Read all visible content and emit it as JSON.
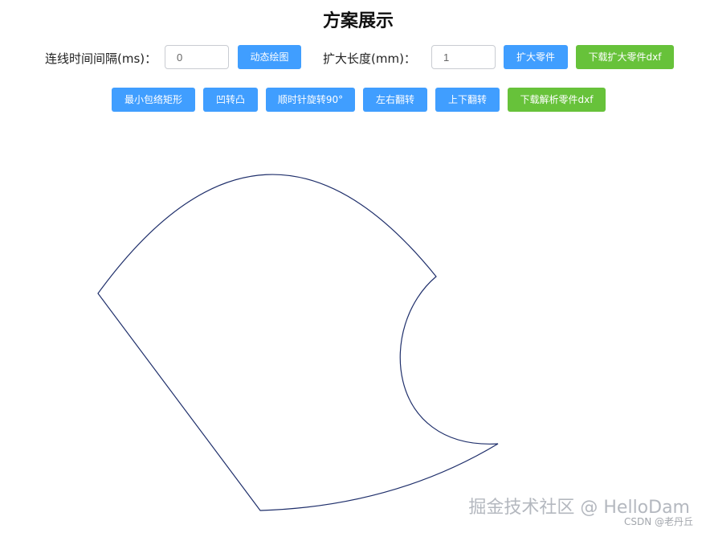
{
  "page": {
    "title": "方案展示"
  },
  "controls": {
    "interval_label": "连线时间间隔(ms)：",
    "interval_value": "0",
    "draw_button": "动态绘图",
    "expand_label": "扩大长度(mm)：",
    "expand_value": "1",
    "expand_button": "扩大零件",
    "download_expanded_button": "下载扩大零件dxf"
  },
  "actions": {
    "min_rect": "最小包络矩形",
    "concave_to_convex": "凹转凸",
    "rotate_cw": "顺时针旋转90°",
    "flip_lr": "左右翻转",
    "flip_ud": "上下翻转",
    "download_parsed": "下载解析零件dxf"
  },
  "colors": {
    "primary": "#409eff",
    "success": "#67c23a",
    "shape_stroke": "#1f2f6b"
  },
  "watermark": {
    "main": "掘金技术社区 @ HelloDam",
    "sub": "CSDN @老丹丘"
  }
}
